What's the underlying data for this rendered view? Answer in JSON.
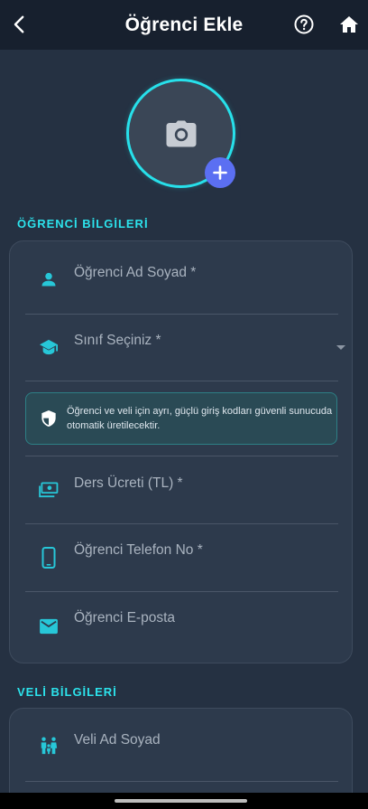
{
  "header": {
    "title": "Öğrenci Ekle",
    "back_icon": "arrow-back-icon",
    "help_icon": "help-circle-icon",
    "home_icon": "home-icon"
  },
  "photo": {
    "camera_icon": "camera-icon",
    "add_icon": "plus-icon",
    "ring_color": "#27e0ea",
    "add_button_color": "#5b6ff2"
  },
  "student_section": {
    "title": "ÖĞRENCİ BİLGİLERİ",
    "fields": {
      "name": {
        "label": "Öğrenci Ad Soyad *",
        "icon": "person-icon"
      },
      "class": {
        "label": "Sınıf Seçiniz *",
        "icon": "graduation-cap-icon"
      },
      "fee": {
        "label": "Ders Ücreti (TL) *",
        "icon": "money-icon"
      },
      "phone": {
        "label": "Öğrenci Telefon No *",
        "icon": "phone-icon"
      },
      "email": {
        "label": "Öğrenci E-posta",
        "icon": "mail-icon"
      }
    },
    "info": {
      "text": "Öğrenci ve veli için ayrı, güçlü giriş kodları güvenli sunucuda otomatik üretilecektir.",
      "icon": "shield-icon"
    }
  },
  "parent_section": {
    "title": "VELİ BİLGİLERİ",
    "fields": {
      "name": {
        "label": "Veli Ad Soyad",
        "icon": "family-icon"
      }
    }
  },
  "colors": {
    "accent": "#2ce3ec",
    "background": "#253142",
    "card": "#2d3a4c",
    "appbar": "#17202e"
  }
}
